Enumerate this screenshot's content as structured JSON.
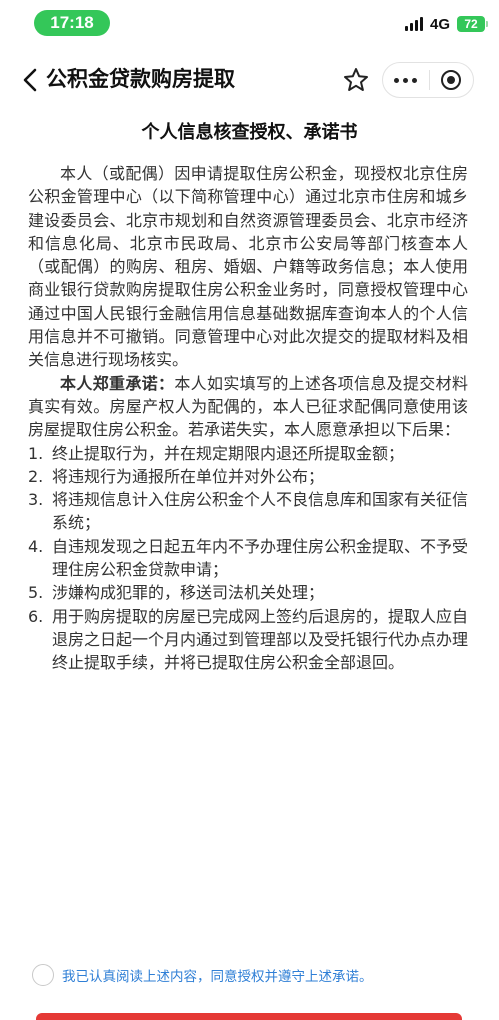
{
  "status_bar": {
    "time": "17:18",
    "network": "4G",
    "battery": "72"
  },
  "nav": {
    "title": "公积金贷款购房提取"
  },
  "document": {
    "title": "个人信息核查授权、承诺书",
    "paragraph1": "本人（或配偶）因申请提取住房公积金，现授权北京住房公积金管理中心（以下简称管理中心）通过北京市住房和城乡建设委员会、北京市规划和自然资源管理委员会、北京市经济和信息化局、北京市民政局、北京市公安局等部门核查本人（或配偶）的购房、租房、婚姻、户籍等政务信息；本人使用商业银行贷款购房提取住房公积金业务时，同意授权管理中心通过中国人民银行金融信用信息基础数据库查询本人的个人信用信息并不可撤销。同意管理中心对此次提交的提取材料及相关信息进行现场核实。",
    "pledge_lead": "本人郑重承诺：",
    "pledge_body": "本人如实填写的上述各项信息及提交材料真实有效。房屋产权人为配偶的，本人已征求配偶同意使用该房屋提取住房公积金。若承诺失实，本人愿意承担以下后果：",
    "consequences": [
      {
        "num": "1.",
        "text": "终止提取行为，并在规定期限内退还所提取金额；"
      },
      {
        "num": "2.",
        "text": "将违规行为通报所在单位并对外公布；"
      },
      {
        "num": "3.",
        "text": "将违规信息计入住房公积金个人不良信息库和国家有关征信系统；"
      },
      {
        "num": "4.",
        "text": "自违规发现之日起五年内不予办理住房公积金提取、不予受理住房公积金贷款申请；"
      },
      {
        "num": "5.",
        "text": "涉嫌构成犯罪的，移送司法机关处理；"
      },
      {
        "num": "6.",
        "text": "用于购房提取的房屋已完成网上签约后退房的，提取人应自退房之日起一个月内通过到管理部以及受托银行代办点办理终止提取手续，并将已提取住房公积金全部退回。"
      }
    ]
  },
  "agreement": {
    "text": "我已认真阅读上述内容，同意授权并遵守上述承诺。",
    "checked": false
  },
  "colors": {
    "status_pill": "#34c759",
    "link_blue": "#2f7fd6",
    "confirm_red": "#e53935"
  }
}
